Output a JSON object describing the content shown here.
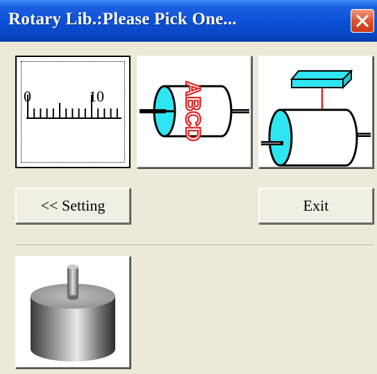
{
  "window": {
    "title": "Rotary Lib.:Please Pick One...",
    "close_glyph": "✕"
  },
  "tiles": [
    {
      "name": "ruler-scale",
      "icon": "ruler-scale-icon",
      "selected": true,
      "scale_start": "0",
      "scale_mid": "10"
    },
    {
      "name": "rotary-label-drum",
      "icon": "label-drum-icon",
      "selected": false,
      "drum_text": "ABCD"
    },
    {
      "name": "rotary-drum-with-block",
      "icon": "drum-block-icon",
      "selected": false
    }
  ],
  "buttons": {
    "setting_label": "<< Setting",
    "exit_label": "Exit"
  },
  "motor_tile": {
    "icon": "motor-cylinder-icon"
  },
  "colors": {
    "title_bar": "#0A4FD6",
    "close_button": "#E0502C",
    "cyan": "#2EE6F2",
    "drum_text": "#E02020",
    "arrow": "#E02020",
    "panel": "#ECE9D8"
  }
}
